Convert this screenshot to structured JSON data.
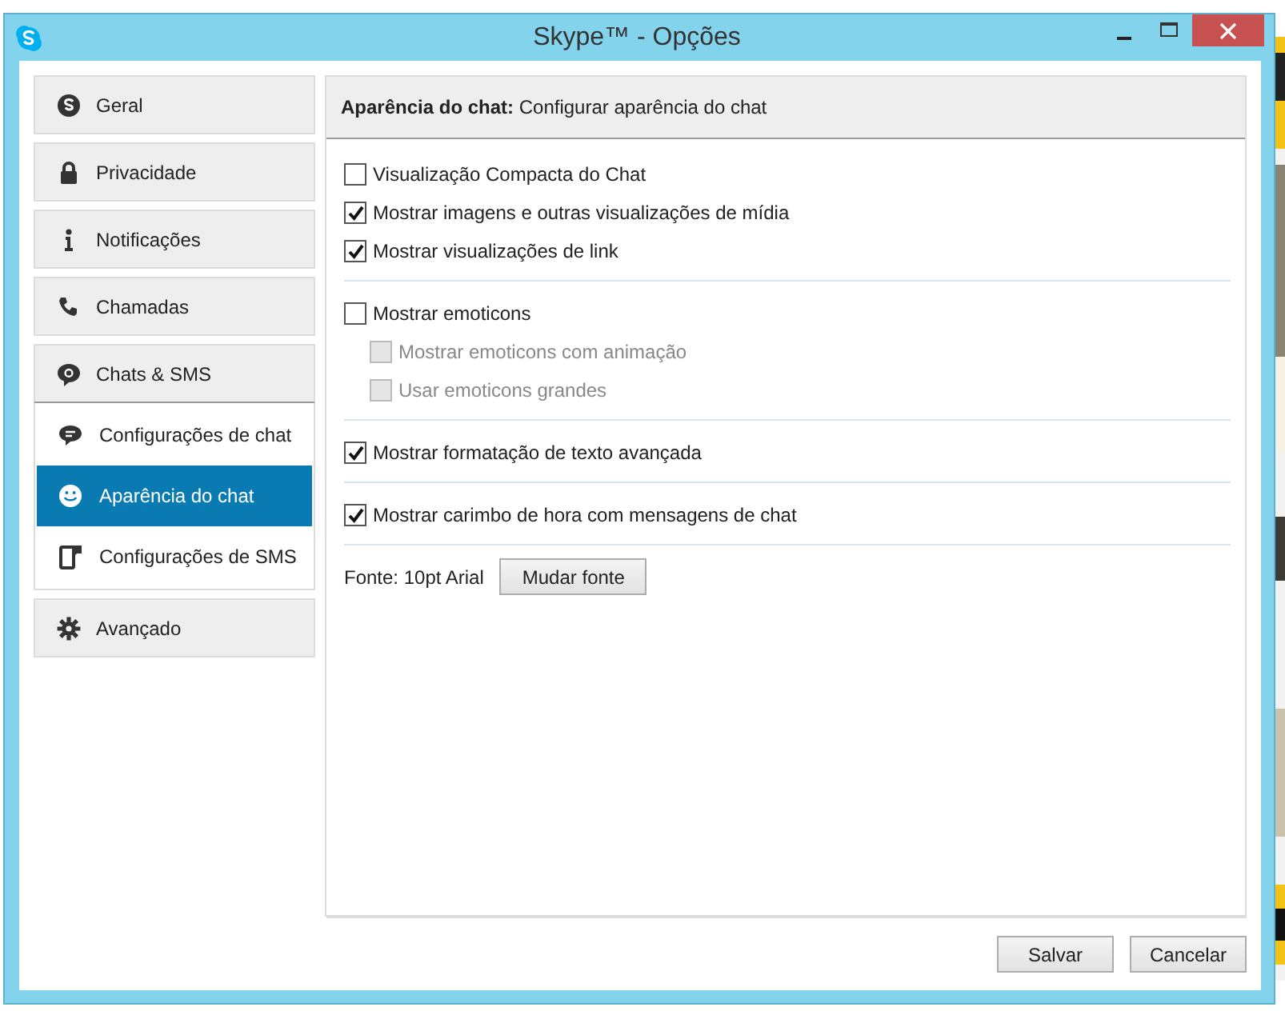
{
  "window": {
    "title": "Skype™ - Opções"
  },
  "sidebar": {
    "items": [
      {
        "label": "Geral",
        "selected": false,
        "expanded": false
      },
      {
        "label": "Privacidade",
        "selected": false,
        "expanded": false
      },
      {
        "label": "Notificações",
        "selected": false,
        "expanded": false
      },
      {
        "label": "Chamadas",
        "selected": false,
        "expanded": false
      },
      {
        "label": "Chats & SMS",
        "selected": false,
        "expanded": true,
        "children": [
          {
            "label": "Configurações de chat",
            "selected": false
          },
          {
            "label": "Aparência do chat",
            "selected": true
          },
          {
            "label": "Configurações de SMS",
            "selected": false
          }
        ]
      },
      {
        "label": "Avançado",
        "selected": false,
        "expanded": false
      }
    ]
  },
  "panel": {
    "header": "**Aparência do chat:** Configurar aparência do chat",
    "groups": [
      {
        "options": [
          {
            "label": "Visualização Compacta do Chat",
            "checked": false,
            "disabled": false
          },
          {
            "label": "Mostrar imagens e outras visualizações de mídia",
            "checked": true,
            "disabled": false
          },
          {
            "label": "Mostrar visualizações de link",
            "checked": true,
            "disabled": false
          }
        ]
      },
      {
        "options": [
          {
            "label": "Mostrar emoticons",
            "checked": false,
            "disabled": false,
            "children": [
              {
                "label": "Mostrar emoticons com animação",
                "checked": false,
                "disabled": true
              },
              {
                "label": "Usar emoticons grandes",
                "checked": false,
                "disabled": true
              }
            ]
          }
        ]
      },
      {
        "options": [
          {
            "label": "Mostrar formatação de texto avançada",
            "checked": true,
            "disabled": false
          }
        ]
      },
      {
        "options": [
          {
            "label": "Mostrar carimbo de hora com mensagens de chat",
            "checked": true,
            "disabled": false
          }
        ]
      }
    ],
    "font": {
      "label": "Fonte: 10pt Arial",
      "button": "Mudar fonte"
    }
  },
  "buttons": [
    "Salvar",
    "Cancelar"
  ]
}
